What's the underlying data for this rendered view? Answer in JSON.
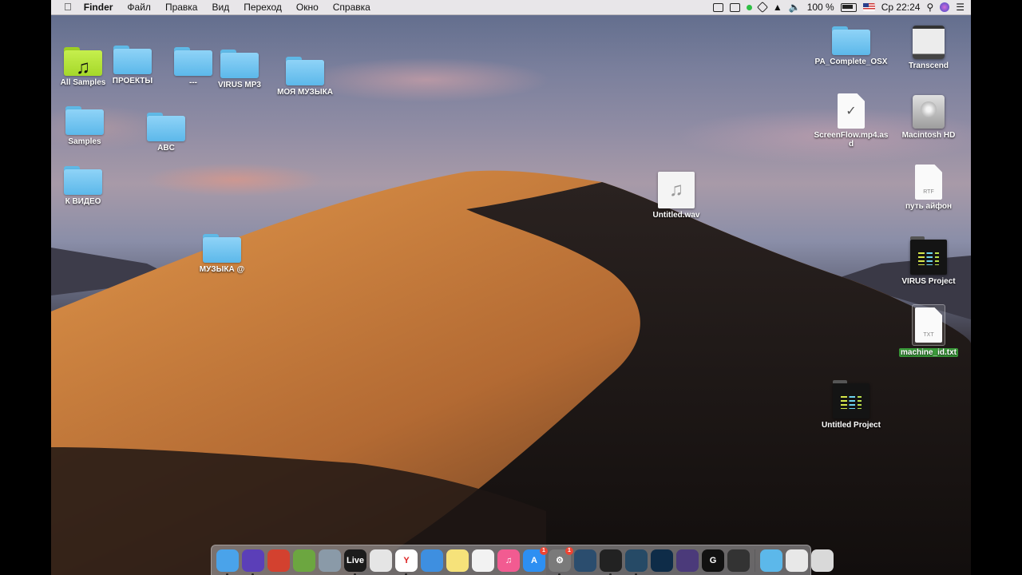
{
  "menubar": {
    "apple": "",
    "app_name": "Finder",
    "menus": [
      "Файл",
      "Правка",
      "Вид",
      "Переход",
      "Окно",
      "Справка"
    ],
    "battery": "100 %",
    "clock": "Ср 22:24",
    "icons": [
      "screen-record-icon",
      "grid-icon",
      "status-dot-icon",
      "universal-audio-icon",
      "wifi-icon",
      "volume-icon",
      "battery-icon",
      "flag-us-icon",
      "search-icon",
      "siri-icon",
      "menu-list-icon"
    ]
  },
  "desktop": {
    "left_icons": [
      {
        "label": "All Samples",
        "kind": "music-folder"
      },
      {
        "label": "ПРОЕКТЫ",
        "kind": "folder"
      },
      {
        "label": "---",
        "kind": "folder"
      },
      {
        "label": "VIRUS MP3",
        "kind": "folder"
      },
      {
        "label": "МОЯ МУЗЫКА",
        "kind": "folder"
      },
      {
        "label": "Samples",
        "kind": "folder"
      },
      {
        "label": "ABC",
        "kind": "folder"
      },
      {
        "label": "К ВИДЕО",
        "kind": "folder"
      },
      {
        "label": "МУЗЫКА @",
        "kind": "folder"
      },
      {
        "label": "Untitled.wav",
        "kind": "audio"
      }
    ],
    "right_icons": [
      {
        "label": "PA_Complete_OSX",
        "kind": "folder"
      },
      {
        "label": "Transcend",
        "kind": "usb-drive"
      },
      {
        "label": "ScreenFlow.mp4.asd",
        "kind": "document"
      },
      {
        "label": "Macintosh HD",
        "kind": "hard-drive"
      },
      {
        "label": "путь айфон",
        "kind": "rtf",
        "tag": "RTF"
      },
      {
        "label": "VIRUS Project",
        "kind": "project"
      },
      {
        "label": "machine_id.txt",
        "kind": "txt",
        "tag": "TXT",
        "selected": true
      },
      {
        "label": "Untitled Project",
        "kind": "project"
      }
    ]
  },
  "dock": {
    "apps": [
      {
        "name": "finder-icon",
        "color": "#4aa3ea",
        "text": ""
      },
      {
        "name": "siri-icon",
        "color": "#5b3fb8",
        "text": ""
      },
      {
        "name": "photo-booth-icon",
        "color": "#d3412f",
        "text": ""
      },
      {
        "name": "memory-icon",
        "color": "#6ca640",
        "text": ""
      },
      {
        "name": "launchpad-icon",
        "color": "#8a9aa8",
        "text": ""
      },
      {
        "name": "ableton-live-icon",
        "color": "#1b1b1b",
        "text": "Live"
      },
      {
        "name": "chrome-icon",
        "color": "#e5e5e5",
        "text": ""
      },
      {
        "name": "yandex-icon",
        "color": "#ffffff",
        "text": "Y"
      },
      {
        "name": "safari-icon",
        "color": "#3e8fe0",
        "text": ""
      },
      {
        "name": "notes-icon",
        "color": "#f6e27a",
        "text": ""
      },
      {
        "name": "photos-icon",
        "color": "#f2f2f2",
        "text": ""
      },
      {
        "name": "itunes-icon",
        "color": "#f25b91",
        "text": "♫"
      },
      {
        "name": "app-store-icon",
        "color": "#2d8ff2",
        "text": "A",
        "badge": "1"
      },
      {
        "name": "system-preferences-icon",
        "color": "#7a7a7a",
        "text": "⚙",
        "badge": "1"
      },
      {
        "name": "ua-console-icon",
        "color": "#2b4d6e",
        "text": ""
      },
      {
        "name": "ua-meter-icon",
        "color": "#222",
        "text": ""
      },
      {
        "name": "ua-connect-icon",
        "color": "#264a66",
        "text": ""
      },
      {
        "name": "audio-app-icon",
        "color": "#0e2c48",
        "text": ""
      },
      {
        "name": "imovie-icon",
        "color": "#4b3a7a",
        "text": ""
      },
      {
        "name": "logitech-icon",
        "color": "#111",
        "text": "G"
      },
      {
        "name": "utility-app-icon",
        "color": "#333",
        "text": ""
      }
    ],
    "stacks": [
      {
        "name": "applications-folder-icon",
        "color": "#5cb8ea",
        "text": ""
      },
      {
        "name": "documents-stack-icon",
        "color": "#e8e8e8",
        "text": ""
      },
      {
        "name": "trash-icon",
        "color": "#d9d9d9",
        "text": ""
      }
    ]
  }
}
